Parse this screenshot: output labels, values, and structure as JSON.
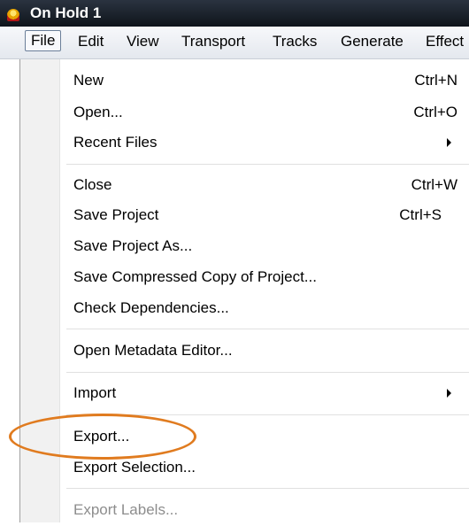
{
  "window": {
    "title": "On Hold 1",
    "app_icon": "audacity-headphones-icon"
  },
  "menubar": {
    "items": [
      "File",
      "Edit",
      "View",
      "Transport",
      "Tracks",
      "Generate",
      "Effect"
    ],
    "active": "File"
  },
  "file_menu": {
    "items": [
      {
        "label": "New",
        "shortcut": "Ctrl+N"
      },
      {
        "label": "Open...",
        "shortcut": "Ctrl+O"
      },
      {
        "label": "Recent Files",
        "submenu": true
      },
      {
        "label": "Close",
        "shortcut": "Ctrl+W"
      },
      {
        "label": "Save Project",
        "shortcut": "Ctrl+S"
      },
      {
        "label": "Save Project As..."
      },
      {
        "label": "Save Compressed Copy of Project..."
      },
      {
        "label": "Check Dependencies..."
      },
      {
        "label": "Open Metadata Editor..."
      },
      {
        "label": "Import",
        "submenu": true
      },
      {
        "label": "Export..."
      },
      {
        "label": "Export Selection..."
      },
      {
        "label": "Export Labels...",
        "disabled": true
      }
    ]
  },
  "annotation": {
    "highlight_color": "#e07b1f",
    "target": "Export..."
  }
}
